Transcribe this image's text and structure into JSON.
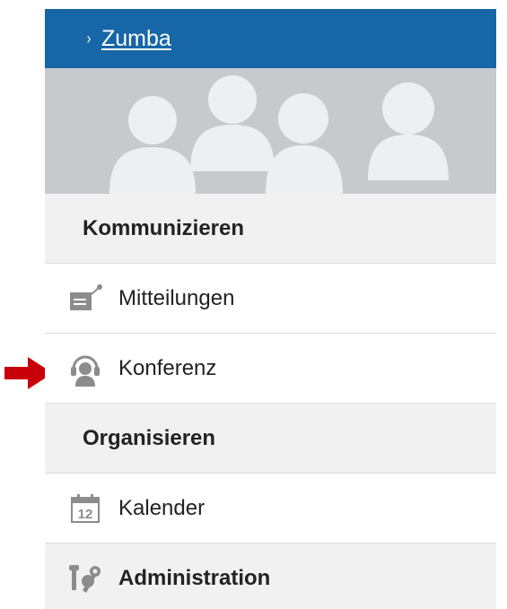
{
  "group": {
    "chevron": "›",
    "name": "Zumba"
  },
  "banner": {
    "icon": "people-avatars"
  },
  "sections": {
    "communicate": "Kommunizieren",
    "organize": "Organisieren",
    "administration": "Administration"
  },
  "items": {
    "messages": "Mitteilungen",
    "conference": "Konferenz",
    "calendar": "Kalender",
    "calendar_day": "12"
  },
  "colors": {
    "header_bg": "#1766a7",
    "banner_bg": "#c7c9cc",
    "arrow": "#c8000a"
  }
}
